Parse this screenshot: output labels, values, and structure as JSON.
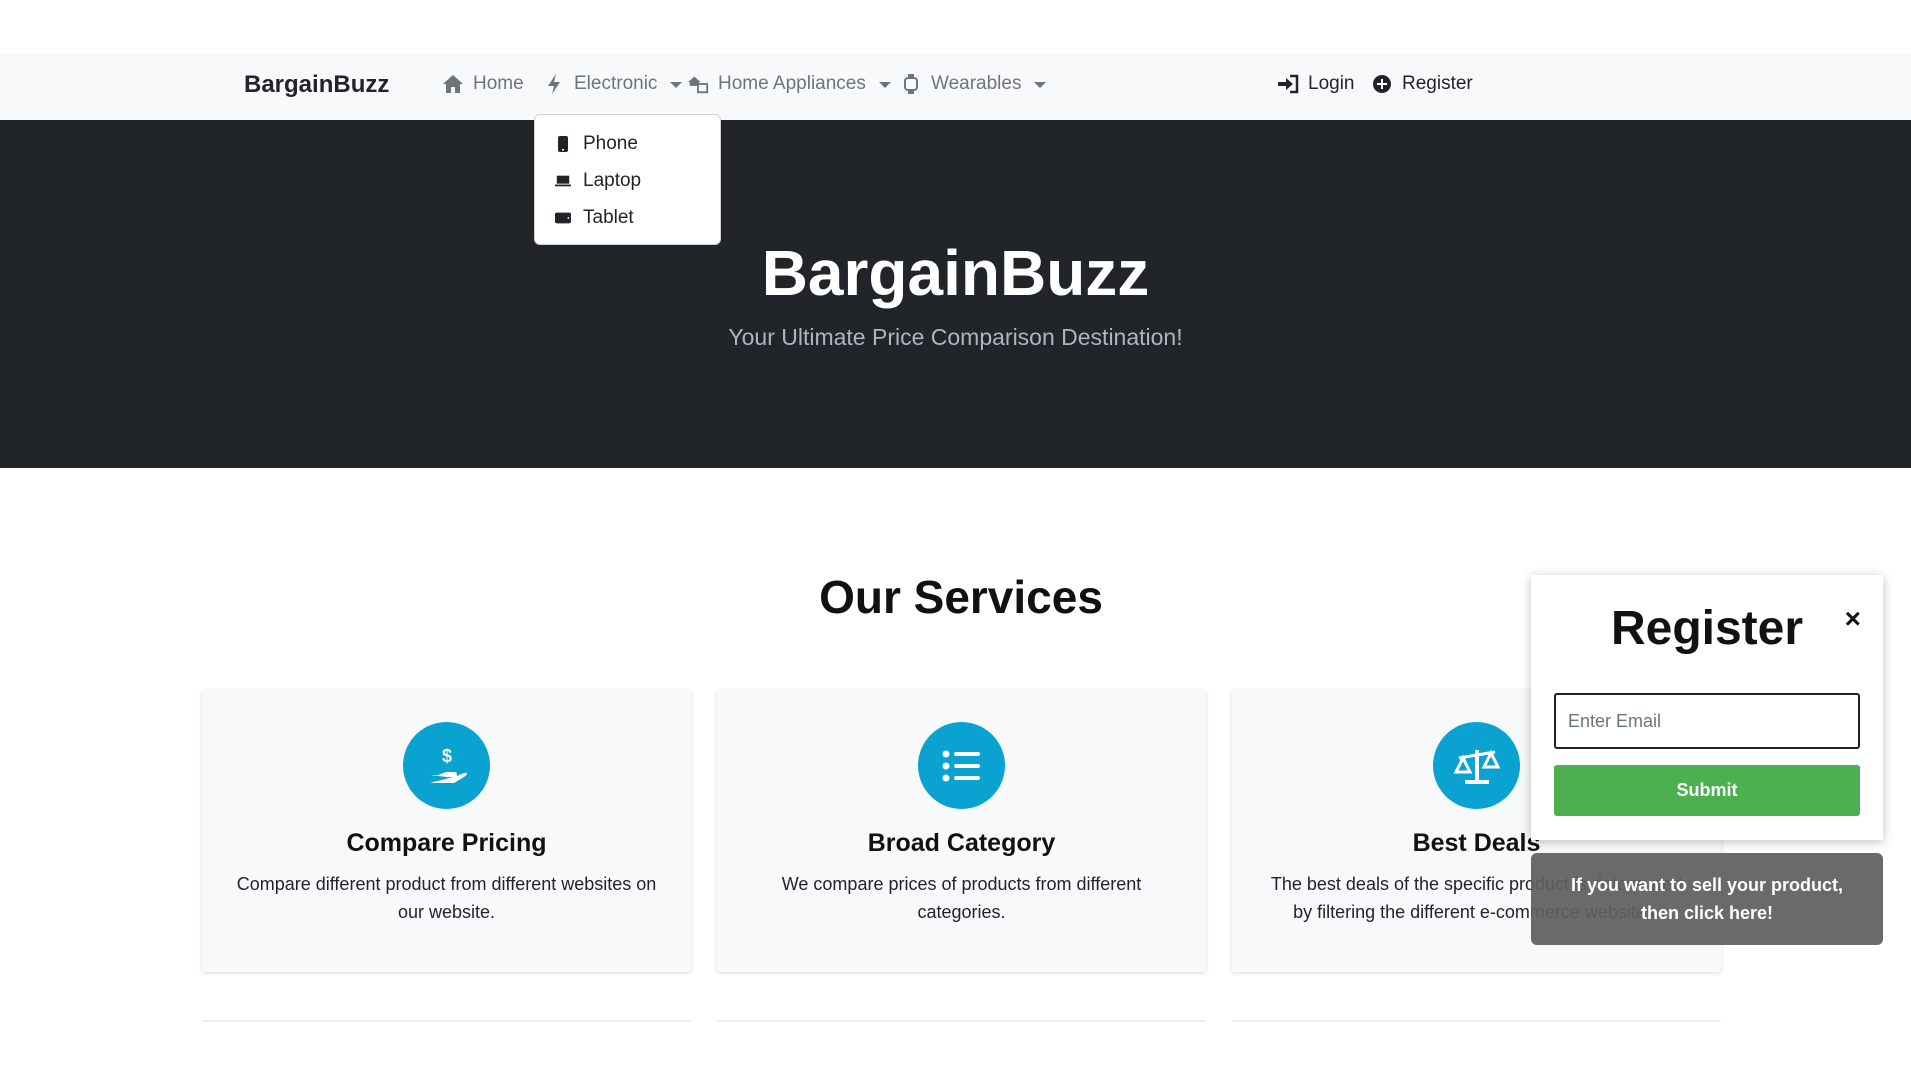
{
  "navbar": {
    "brand": "BargainBuzz",
    "items": [
      {
        "label": "Home",
        "icon": "home-icon"
      },
      {
        "label": "Electronic",
        "icon": "bolt-icon"
      },
      {
        "label": "Home Appliances",
        "icon": "appliance-icon"
      },
      {
        "label": "Wearables",
        "icon": "watch-icon"
      }
    ],
    "login": "Login",
    "register": "Register"
  },
  "dropdown": {
    "items": [
      {
        "label": "Phone",
        "icon": "phone-icon"
      },
      {
        "label": "Laptop",
        "icon": "laptop-icon"
      },
      {
        "label": "Tablet",
        "icon": "tablet-icon"
      }
    ]
  },
  "hero": {
    "title": "BargainBuzz",
    "subtitle": "Your Ultimate Price Comparison Destination!"
  },
  "services": {
    "title": "Our Services",
    "cards": [
      {
        "title": "Compare Pricing",
        "text": "Compare different product from different websites on our website.",
        "icon": "hand-dollar-icon"
      },
      {
        "title": "Broad Category",
        "text": "We compare prices of products from different categories.",
        "icon": "list-icon"
      },
      {
        "title": "Best Deals",
        "text": "The best deals of the specific product is determined by filtering the different e-commerce websites.",
        "icon": "scale-icon"
      }
    ]
  },
  "register_popup": {
    "title": "Register",
    "close": "×",
    "email_placeholder": "Enter Email",
    "submit": "Submit"
  },
  "sell_toast": {
    "line1": "If you want to sell your product,",
    "line2": "then click here!"
  },
  "colors": {
    "accent": "#0aa3d1",
    "submit": "#4caf50",
    "hero_bg": "#212529",
    "navbar_bg": "#f8f9fa"
  }
}
